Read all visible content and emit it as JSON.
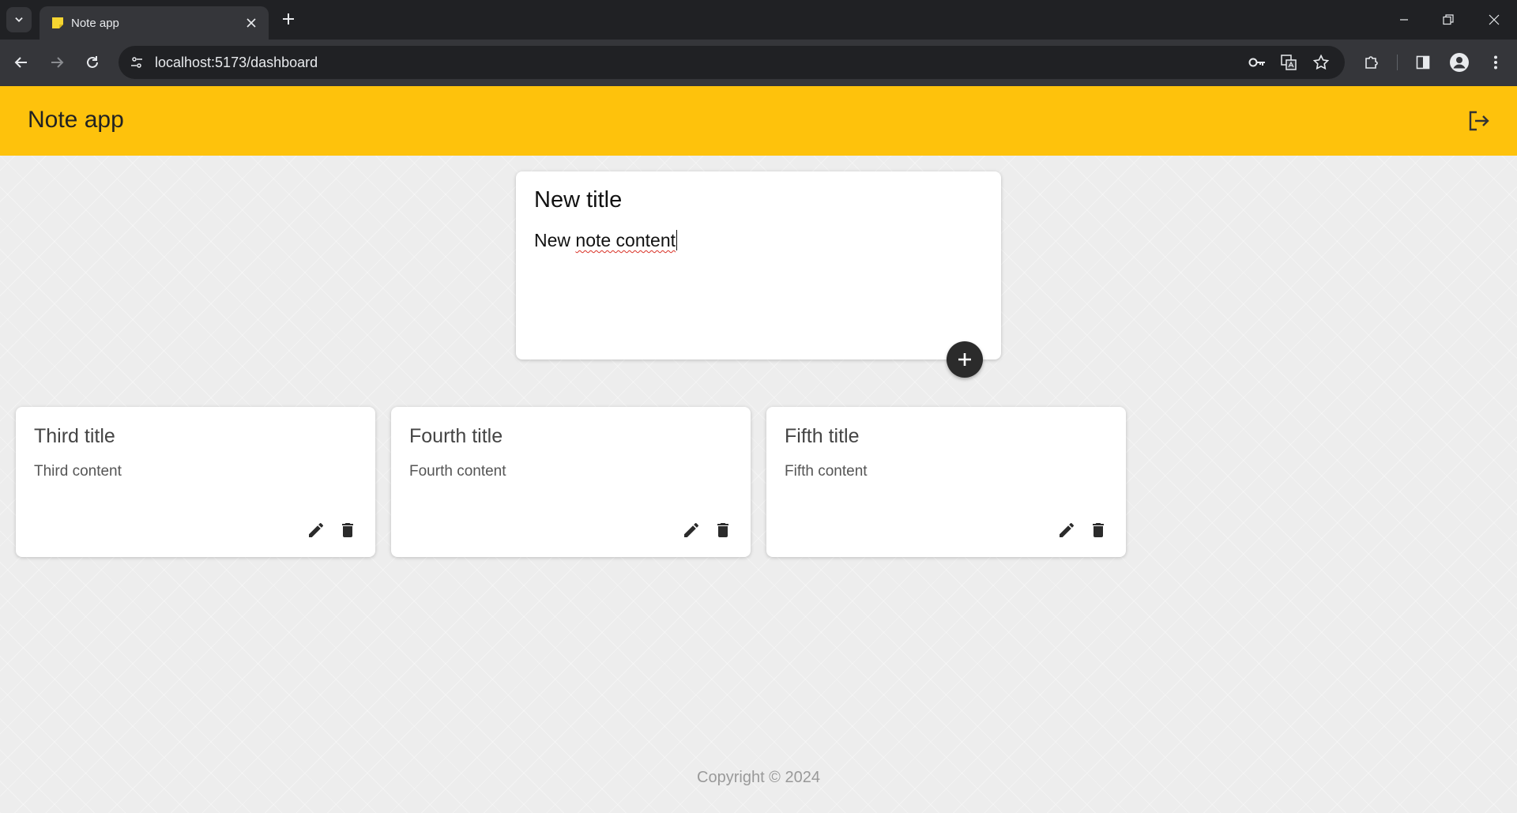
{
  "browser": {
    "tab_title": "Note app",
    "url": "localhost:5173/dashboard"
  },
  "app": {
    "title": "Note app",
    "accent_color": "#fec20c"
  },
  "create_note": {
    "title_value": "New title",
    "content_prefix": "New ",
    "content_misspelled": "note content"
  },
  "notes": [
    {
      "title": "Third title",
      "content": "Third content"
    },
    {
      "title": "Fourth title",
      "content": "Fourth content"
    },
    {
      "title": "Fifth title",
      "content": "Fifth content"
    }
  ],
  "footer": {
    "copyright": "Copyright © 2024"
  },
  "icons": {
    "logout": "logout-icon",
    "add": "plus-icon",
    "edit": "pencil-icon",
    "delete": "trash-icon"
  }
}
